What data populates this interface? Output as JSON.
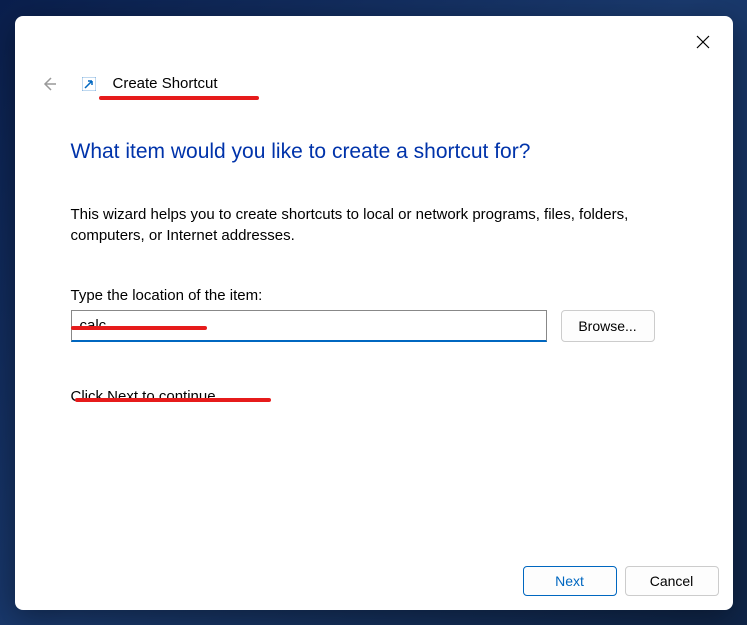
{
  "dialog": {
    "title": "Create Shortcut",
    "heading": "What item would you like to create a shortcut for?",
    "description": "This wizard helps you to create shortcuts to local or network programs, files, folders, computers, or Internet addresses.",
    "input_label": "Type the location of the item:",
    "input_value": "calc",
    "browse_label": "Browse...",
    "continue_text": "Click Next to continue.",
    "next_label": "Next",
    "cancel_label": "Cancel"
  }
}
